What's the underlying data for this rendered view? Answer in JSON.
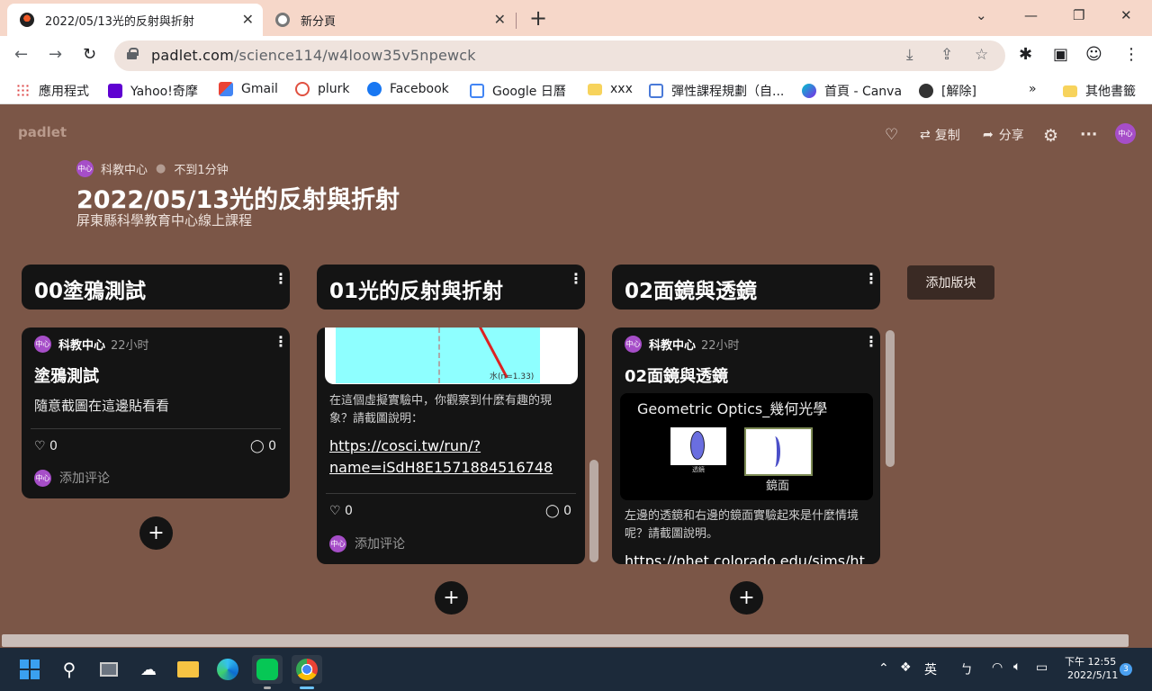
{
  "browser": {
    "tabs": [
      {
        "title": "2022/05/13光的反射與折射",
        "active": true
      },
      {
        "title": "新分頁",
        "active": false
      }
    ],
    "new_tab": "+",
    "window_controls": {
      "dropdown": "⌄",
      "minimize": "—",
      "restore": "❐",
      "close": "✕"
    },
    "url_domain": "padlet.com",
    "url_path": "/science114/w4loow35v5npewck",
    "nav": {
      "back": "←",
      "forward": "→",
      "reload": "↻"
    },
    "bookmarks": [
      "應用程式",
      "Yahoo!奇摩",
      "Gmail",
      "plurk",
      "Facebook",
      "Google 日曆",
      "xxx",
      "彈性課程規劃（自...",
      "首頁 - Canva",
      "[解除]"
    ],
    "bookmarks_more": "»",
    "other_bookmarks": "其他書籤"
  },
  "padlet": {
    "logo": "padlet",
    "remake_label": "复制",
    "share_label": "分享",
    "author": "科教中心",
    "avatar_text": "中心",
    "updated": "不到1分钟",
    "title": "2022/05/13光的反射與折射",
    "subtitle": "屏東縣科學教育中心線上課程",
    "add_section": "添加版块",
    "columns": [
      {
        "title": "00塗鴉測試",
        "card": {
          "author": "科教中心",
          "time": "22小时",
          "title": "塗鴉測試",
          "body": "隨意截圖在這邊貼看看",
          "likes": "0",
          "comments": "0",
          "add_comment": "添加评论"
        }
      },
      {
        "title": "01光的反射與折射",
        "card": {
          "image_label": "水(n=1.33)",
          "body": "在這個虛擬實驗中，你觀察到什麼有趣的現象？請截圖說明：",
          "link_line1": "https://cosci.tw/run/?",
          "link_line2": "name=iSdH8E1571884516748",
          "likes": "0",
          "comments": "0",
          "add_comment": "添加评论"
        }
      },
      {
        "title": "02面鏡與透鏡",
        "card": {
          "author": "科教中心",
          "time": "22小时",
          "title": "02面鏡與透鏡",
          "image_title": "Geometric Optics_幾何光學",
          "lens_caption": "透鏡",
          "mirror_caption": "鏡面",
          "body": "左邊的透鏡和右邊的鏡面實驗起來是什麼情境呢？請截圖說明。",
          "link_partial": "https://phet.colorado.edu/sims/ht"
        }
      }
    ]
  },
  "taskbar": {
    "ime_lang": "英",
    "ime_mode": "ㄅ",
    "time": "下午 12:55",
    "date": "2022/5/11",
    "notifications": "3"
  },
  "colors": {
    "board_bg": "#7b5647",
    "card_bg": "#141414",
    "avatar": "#a64ec8",
    "tab_strip": "#f6d7c9"
  }
}
